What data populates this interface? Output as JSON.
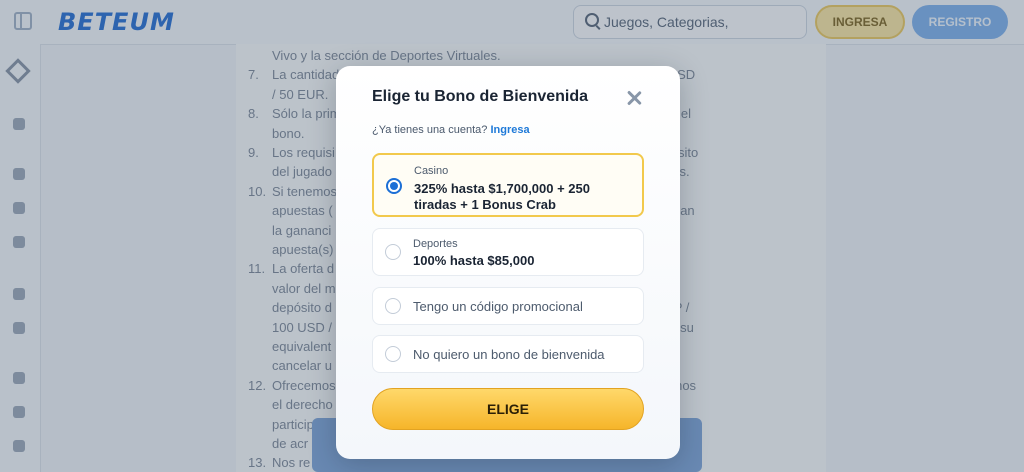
{
  "header": {
    "logo": "BETEUM",
    "search_placeholder": "Juegos, Categorias, Proveedores",
    "login_label": "INGRESA",
    "register_label": "REGISTRO"
  },
  "background_text": {
    "lines": [
      {
        "num": "",
        "text": "Vivo y la sección de Deportes Virtuales."
      },
      {
        "num": "7.",
        "text": "La cantidad                                                           de 42,500 CLP / 50 USD"
      },
      {
        "num": "",
        "text": "/ 50 EUR."
      },
      {
        "num": "8.",
        "text": "Sólo la prim                                                          requisitos de rollover del"
      },
      {
        "num": "",
        "text": "bono."
      },
      {
        "num": "9.",
        "text": "Los requisi                                                            eriores al primer depósito"
      },
      {
        "num": "",
        "text": "del jugado                                                               cias correspondientes."
      },
      {
        "num": "10.",
        "text": "Si tenemos                                                           uesta o una serie de"
      },
      {
        "num": "",
        "text": "apuestas (                                                             os resultados garantizan"
      },
      {
        "num": "",
        "text": "la gananci                                                              bono, anular la(s)"
      },
      {
        "num": "",
        "text": "apuesta(s)                                                              ta(s)."
      },
      {
        "num": "11.",
        "text": "La oferta d                                                           nancia de 10 veces el"
      },
      {
        "num": "",
        "text": "valor del m                                                             n bono de primer"
      },
      {
        "num": "",
        "text": "depósito d                                                              r valor de 85,000 CLP /"
      },
      {
        "num": "",
        "text": "100 USD /                                                               USD / 1,000 EUR (o su"
      },
      {
        "num": "",
        "text": "equivalent                                                              l bono. Podemos"
      },
      {
        "num": "",
        "text": "cancelar u                                                              a su bono."
      },
      {
        "num": "12.",
        "text": "Ofrecemos                                                             ativos y nos reservamos"
      },
      {
        "num": "",
        "text": "el derecho                                                              o elegible para"
      },
      {
        "num": "",
        "text": "particip                                                                amento, inclu"
      },
      {
        "num": "",
        "text": "de acr                                                                  inculados a"
      },
      {
        "num": "13.",
        "text": "Nos re                                                               factoria par"
      }
    ]
  },
  "modal": {
    "title": "Elige tu Bono de Bienvenida",
    "account_question": "¿Ya tienes una cuenta?",
    "account_link": "Ingresa",
    "options": [
      {
        "label": "Casino",
        "text_line1": "325% hasta $1,700,000 + 250",
        "text_line2": "tiradas + 1 Bonus Crab",
        "selected": true
      },
      {
        "label": "Deportes",
        "text_line1": "100% hasta $85,000",
        "selected": false
      },
      {
        "text": "Tengo un código promocional",
        "selected": false
      },
      {
        "text": "No quiero un bono de bienvenida",
        "selected": false
      }
    ],
    "submit_label": "ELIGE"
  },
  "colors": {
    "accent_blue": "#1c6fd6",
    "accent_yellow": "#f6b52a",
    "selected_border": "#f2c94c"
  }
}
